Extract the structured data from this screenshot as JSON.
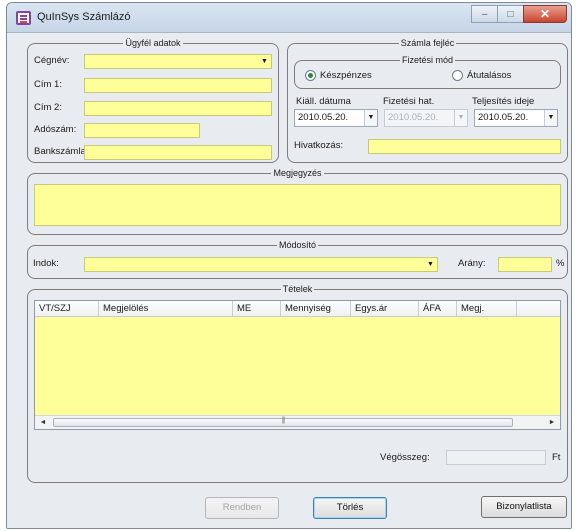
{
  "window": {
    "title": "QuInSys Számlázó",
    "minimize_glyph": "‒",
    "maximize_glyph": "□",
    "close_glyph": "✕",
    "app_icon": "invoice-app-icon"
  },
  "customer": {
    "group_title": "Ügyfél adatok",
    "name_label": "Cégnév:",
    "name_value": "",
    "addr1_label": "Cím 1:",
    "addr1_value": "",
    "addr2_label": "Cím 2:",
    "addr2_value": "",
    "tax_label": "Adószám:",
    "tax_value": "",
    "bank_label": "Bankszámla:",
    "bank_value": ""
  },
  "invoice": {
    "group_title": "Számla fejléc",
    "payment_group_title": "Fizetési mód",
    "cash_label": "Készpénzes",
    "transfer_label": "Átutalásos",
    "selected_payment": "cash",
    "issue_date_label": "Kiáll. dátuma",
    "issue_date": "2010.05.20.",
    "due_date_label": "Fizetési hat.",
    "due_date": "2010.05.20.",
    "delivery_date_label": "Teljesítés ideje",
    "delivery_date": "2010.05.20.",
    "reference_label": "Hivatkozás:",
    "reference_value": ""
  },
  "notes": {
    "group_title": "Megjegyzés",
    "value": ""
  },
  "modifier": {
    "group_title": "Módosító",
    "reason_label": "Indok:",
    "reason_value": "",
    "ratio_label": "Arány:",
    "ratio_value": "",
    "percent_sign": "%"
  },
  "items": {
    "group_title": "Tételek",
    "columns": [
      "VT/SZJ",
      "Megjelölés",
      "ME",
      "Mennyiség",
      "Egys.ár",
      "ÁFA",
      "Megj."
    ],
    "rows": [],
    "total_label": "Végösszeg:",
    "total_value": "",
    "currency": "Ft"
  },
  "buttons": {
    "save": "Rendben",
    "clear": "Törlés",
    "receipt": "Bizonylatlista"
  },
  "colors": {
    "field_yellow": "#ffff9a",
    "close_red": "#c7452f"
  }
}
